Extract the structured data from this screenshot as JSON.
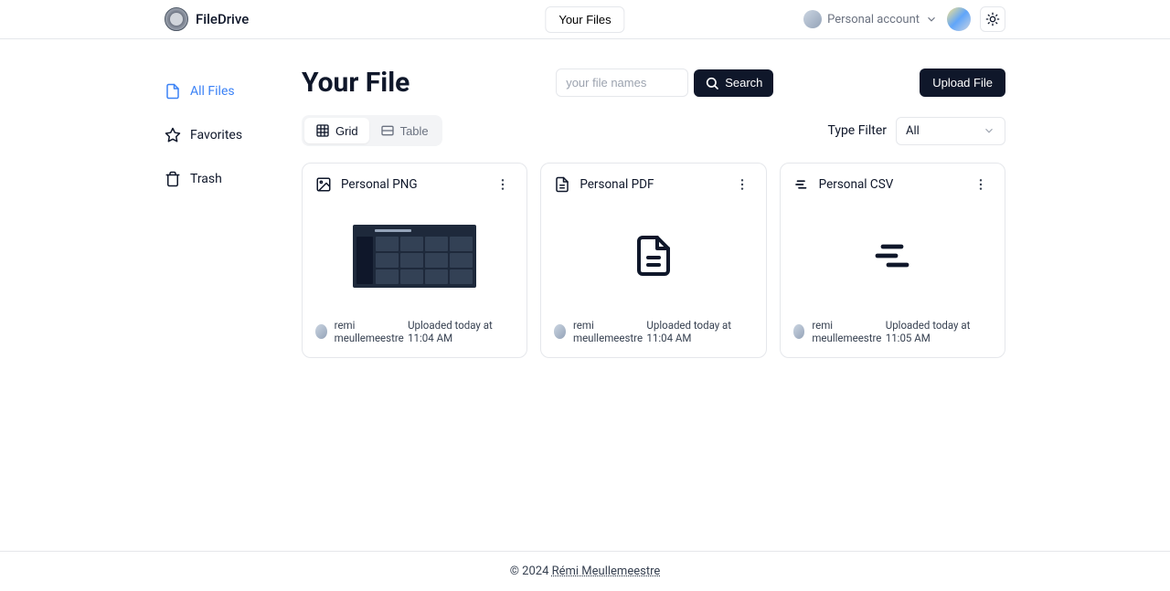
{
  "header": {
    "app_name": "FileDrive",
    "center_button": "Your Files",
    "account_label": "Personal account"
  },
  "sidebar": {
    "items": [
      {
        "label": "All Files"
      },
      {
        "label": "Favorites"
      },
      {
        "label": "Trash"
      }
    ]
  },
  "main": {
    "title": "Your File",
    "search_placeholder": "your file names",
    "search_button": "Search",
    "upload_button": "Upload File",
    "view_tabs": {
      "grid": "Grid",
      "table": "Table"
    },
    "filter": {
      "label": "Type Filter",
      "value": "All"
    }
  },
  "files": [
    {
      "title": "Personal PNG",
      "type": "image",
      "uploader": "remi meullemeestre",
      "uploaded": "Uploaded today at 11:04 AM"
    },
    {
      "title": "Personal PDF",
      "type": "pdf",
      "uploader": "remi meullemeestre",
      "uploaded": "Uploaded today at 11:04 AM"
    },
    {
      "title": "Personal CSV",
      "type": "csv",
      "uploader": "remi meullemeestre",
      "uploaded": "Uploaded today at 11:05 AM"
    }
  ],
  "footer": {
    "copyright": "© 2024 ",
    "author": "Rémi Meullemeestre"
  }
}
